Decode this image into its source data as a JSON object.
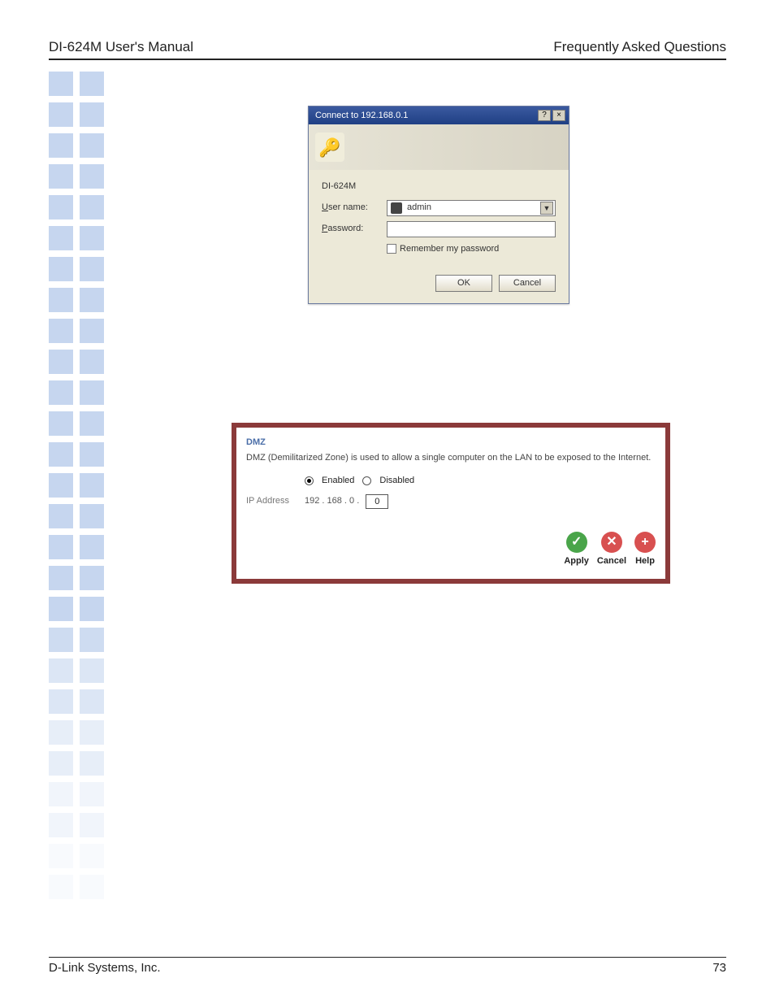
{
  "header": {
    "left": "DI-624M User's Manual",
    "right": "Frequently Asked Questions"
  },
  "dialog": {
    "title": "Connect to 192.168.0.1",
    "realm": "DI-624M",
    "username_label_pre": "U",
    "username_label_rest": "ser name:",
    "password_label_pre": "P",
    "password_label_rest": "assword:",
    "username_value": "admin",
    "remember_pre": "R",
    "remember_rest": "emember my password",
    "ok": "OK",
    "cancel": "Cancel"
  },
  "dmz": {
    "title": "DMZ",
    "desc": "DMZ (Demilitarized Zone) is used to allow a single computer on the LAN to be exposed to the Internet.",
    "enabled_label": "Enabled",
    "disabled_label": "Disabled",
    "ip_label": "IP Address",
    "ip_prefix": "192 . 168 . 0 .",
    "ip_last": "0",
    "apply": "Apply",
    "cancel": "Cancel",
    "help": "Help"
  },
  "footer": {
    "left": "D-Link Systems, Inc.",
    "right": "73"
  }
}
